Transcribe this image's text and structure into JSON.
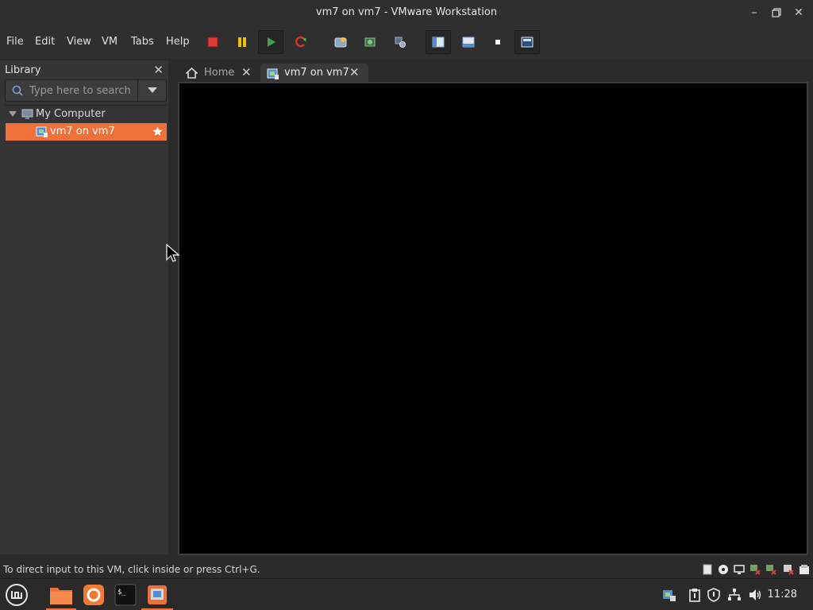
{
  "window": {
    "title": "vm7 on vm7 - VMware Workstation",
    "minimize_icon": "minimize-icon",
    "restore_icon": "restore-icon",
    "close_icon": "close-icon"
  },
  "menu": {
    "items": [
      "File",
      "Edit",
      "View",
      "VM",
      "Tabs",
      "Help"
    ]
  },
  "toolbar": {
    "buttons": [
      {
        "name": "power-off",
        "icon": "stop-square-icon",
        "color": "#e53935"
      },
      {
        "name": "suspend",
        "icon": "pause-icon",
        "color": "#f5c400"
      },
      {
        "name": "power-on",
        "icon": "play-icon",
        "color": "#3fa34d"
      },
      {
        "name": "restart",
        "icon": "refresh-icon",
        "color": "#d23a2e"
      },
      {
        "name": "send-ctrl-alt-del",
        "icon": "keyboard-icon"
      },
      {
        "name": "snapshot",
        "icon": "snapshot-icon"
      },
      {
        "name": "snapshot-manager",
        "icon": "snapshot-manager-icon"
      },
      {
        "name": "show-library",
        "icon": "library-view-icon"
      },
      {
        "name": "thumbnail-bar",
        "icon": "thumbnail-view-icon"
      },
      {
        "name": "unity",
        "icon": "unity-icon"
      },
      {
        "name": "full-screen",
        "icon": "fullscreen-icon"
      }
    ]
  },
  "library": {
    "header": "Library",
    "search_placeholder": "Type here to search",
    "tree": [
      {
        "label": "My Computer",
        "icon": "computer-icon",
        "expanded": true
      },
      {
        "label": "vm7 on vm7",
        "icon": "vm-icon",
        "selected": true,
        "favorite": true
      }
    ]
  },
  "tabs": [
    {
      "label": "Home",
      "icon": "home-icon",
      "active": false
    },
    {
      "label": "vm7 on vm7",
      "icon": "vm-icon",
      "active": true
    }
  ],
  "statusbar": {
    "message": "To direct input to this VM, click inside or press Ctrl+G.",
    "device_icons": [
      "hard-disk-icon",
      "cd-icon",
      "display-icon",
      "network-disconnected-icon",
      "usb-disconnected-icon",
      "sound-icon"
    ]
  },
  "taskbar": {
    "apps": [
      "mint-menu-icon",
      "files-icon",
      "firefox-icon",
      "terminal-icon",
      "vmware-icon"
    ],
    "tray": [
      "vmware-tray-icon",
      "clipboard-icon",
      "shield-icon",
      "network-icon",
      "volume-icon"
    ],
    "clock": "11:28"
  },
  "colors": {
    "accent": "#f0703a",
    "console": "#000000"
  }
}
